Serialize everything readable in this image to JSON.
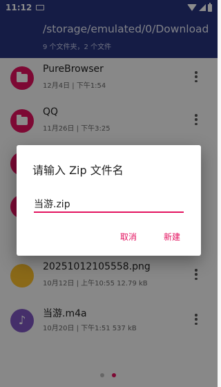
{
  "status_bar": {
    "time": "11:12"
  },
  "app_bar": {
    "path": "/storage/emulated/0/Download",
    "summary": "9 个文件夹，2 个文件"
  },
  "files": [
    {
      "name": "PureBrowser",
      "meta": "12月4日 | 下午1:54",
      "icon": "folder-icon"
    },
    {
      "name": "QQ",
      "meta": "11月26日 | 下午3:25",
      "icon": "folder-icon"
    },
    {
      "name": "",
      "meta": "",
      "icon": "folder-icon"
    },
    {
      "name": "",
      "meta": "",
      "icon": "folder-icon"
    },
    {
      "name": "20251012105558.png",
      "meta": "10月12日 | 上午10:55   12.79 kB",
      "icon": "image-icon"
    },
    {
      "name": "当游.m4a",
      "meta": "10月20日 | 下午1:51   537 kB",
      "icon": "music-note-icon"
    }
  ],
  "dialog": {
    "title": "请输入 Zip 文件名",
    "input_value": "当游.zip",
    "cancel_label": "取消",
    "create_label": "新建"
  },
  "colors": {
    "app_bar": "#27347e",
    "accent": "#e3125f",
    "folder_icon_bg": "#e3125f",
    "audio_icon_bg": "#7e57c2"
  }
}
